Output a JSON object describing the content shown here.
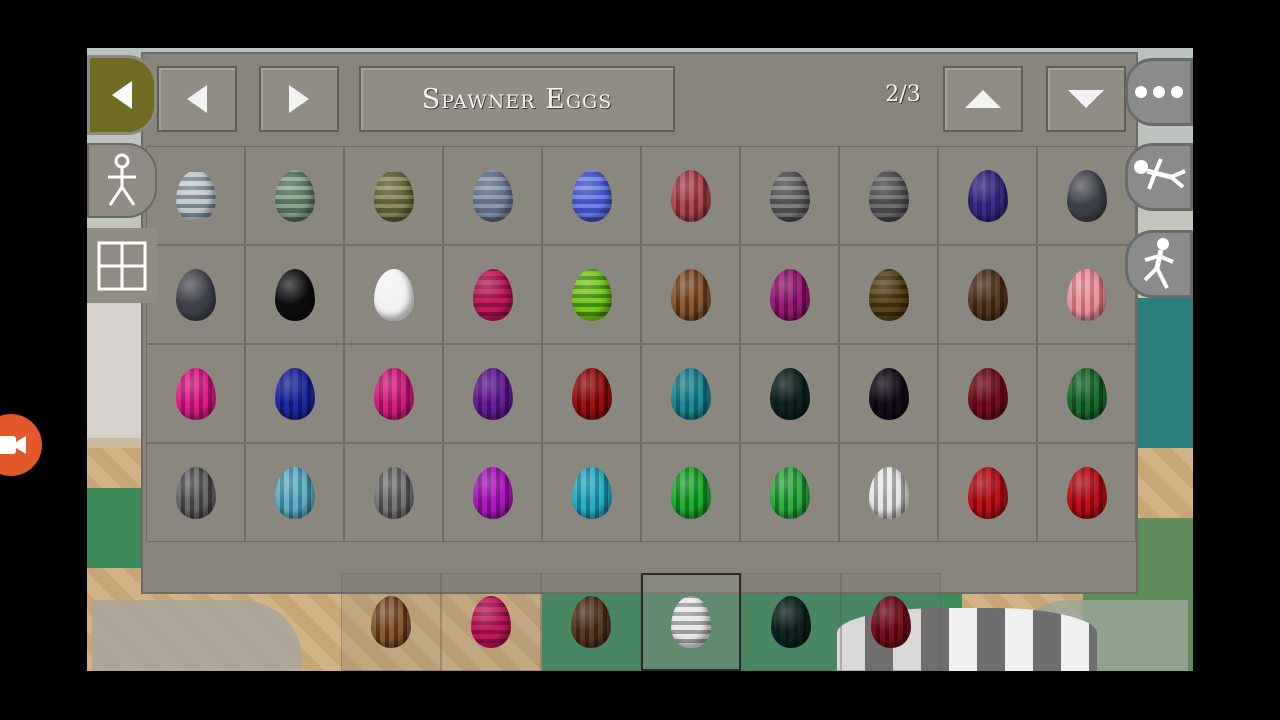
{
  "inventory": {
    "title": "Spawner Eggs",
    "page": "2/3"
  },
  "icons": {
    "back": "back-arrow-icon",
    "prev": "left-arrow-icon",
    "next": "right-arrow-icon",
    "up": "up-arrow-icon",
    "down": "down-arrow-icon",
    "menu": "more-dots-icon",
    "walk": "stickman-walk-icon",
    "grid": "grid-icon",
    "fly": "stickman-fly-icon",
    "run": "stickman-run-icon",
    "record": "video-camera-icon"
  },
  "eggs": [
    [
      {
        "base": "#c8c8c8",
        "stripe": "#6e8796",
        "pattern": "h"
      },
      {
        "base": "#4f7056",
        "stripe": "#8ea18e",
        "pattern": "h"
      },
      {
        "base": "#5b5a35",
        "stripe": "#8e8b58",
        "pattern": "h"
      },
      {
        "base": "#5d6a82",
        "stripe": "#8797ad",
        "pattern": "h"
      },
      {
        "base": "#3e4fbf",
        "stripe": "#6d80e6",
        "pattern": "h"
      },
      {
        "base": "#b04a52",
        "stripe": "#7e2a32",
        "pattern": "v"
      },
      {
        "base": "#4c4c4c",
        "stripe": "#7d7d7d",
        "pattern": "h"
      },
      {
        "base": "#474747",
        "stripe": "#6f6f6f",
        "pattern": "h"
      },
      {
        "base": "#2c1f6a",
        "stripe": "#3c2c8c",
        "pattern": "v"
      },
      {
        "base": "#3d4048",
        "stripe": "#3d4048",
        "pattern": "solid"
      }
    ],
    [
      {
        "base": "#3d4048",
        "stripe": "#3d4048",
        "pattern": "solid"
      },
      {
        "base": "#0c0c0c",
        "stripe": "#0c0c0c",
        "pattern": "solid"
      },
      {
        "base": "#f2f2f2",
        "stripe": "#f2f2f2",
        "pattern": "solid"
      },
      {
        "base": "#c2185b",
        "stripe": "#8e0f43",
        "pattern": "h"
      },
      {
        "base": "#79c81e",
        "stripe": "#3f8c12",
        "pattern": "h"
      },
      {
        "base": "#8a5a30",
        "stripe": "#5a3418",
        "pattern": "v"
      },
      {
        "base": "#9c1a7a",
        "stripe": "#6a0e52",
        "pattern": "v"
      },
      {
        "base": "#5c4618",
        "stripe": "#3a2c0c",
        "pattern": "h"
      },
      {
        "base": "#5a3a24",
        "stripe": "#3a2414",
        "pattern": "v"
      },
      {
        "base": "#e89aa0",
        "stripe": "#c36a72",
        "pattern": "v"
      }
    ],
    [
      {
        "base": "#e0208a",
        "stripe": "#a8106a",
        "pattern": "v"
      },
      {
        "base": "#1e2aa8",
        "stripe": "#121a72",
        "pattern": "v"
      },
      {
        "base": "#d81e82",
        "stripe": "#a01060",
        "pattern": "v"
      },
      {
        "base": "#6a1e98",
        "stripe": "#4a1070",
        "pattern": "v"
      },
      {
        "base": "#9a1212",
        "stripe": "#6a0808",
        "pattern": "v"
      },
      {
        "base": "#1e8a98",
        "stripe": "#106070",
        "pattern": "v"
      },
      {
        "base": "#0e2420",
        "stripe": "#0a1a16",
        "pattern": "v"
      },
      {
        "base": "#150f1a",
        "stripe": "#0c0810",
        "pattern": "v"
      },
      {
        "base": "#7a0e1e",
        "stripe": "#500812",
        "pattern": "v"
      },
      {
        "base": "#1a7030",
        "stripe": "#0e4a1c",
        "pattern": "v"
      }
    ],
    [
      {
        "base": "#6a6a6a",
        "stripe": "#3e3e3e",
        "pattern": "v"
      },
      {
        "base": "#62b0c8",
        "stripe": "#3a8098",
        "pattern": "v"
      },
      {
        "base": "#7a7a7a",
        "stripe": "#4c4c4c",
        "pattern": "v"
      },
      {
        "base": "#b018c0",
        "stripe": "#7c0e88",
        "pattern": "v"
      },
      {
        "base": "#28b0c8",
        "stripe": "#167c90",
        "pattern": "v"
      },
      {
        "base": "#20b030",
        "stripe": "#107a1e",
        "pattern": "v"
      },
      {
        "base": "#30b040",
        "stripe": "#18782a",
        "pattern": "v"
      },
      {
        "base": "#e8e8e8",
        "stripe": "#9a9a9a",
        "pattern": "v"
      },
      {
        "base": "#c01018",
        "stripe": "#8a0810",
        "pattern": "v"
      },
      {
        "base": "#c01018",
        "stripe": "#8a0810",
        "pattern": "v"
      }
    ]
  ],
  "hotbar": [
    {
      "base": "#8a5a30",
      "stripe": "#5a3418",
      "pattern": "v"
    },
    {
      "base": "#c2185b",
      "stripe": "#8e0f43",
      "pattern": "h"
    },
    {
      "base": "#5a3a24",
      "stripe": "#3a2414",
      "pattern": "v"
    },
    {
      "base": "#e8e8e8",
      "stripe": "#9a9a9a",
      "pattern": "h"
    },
    {
      "base": "#0e2420",
      "stripe": "#0a1a16",
      "pattern": "v"
    },
    {
      "base": "#7a0e1e",
      "stripe": "#500812",
      "pattern": "v"
    }
  ],
  "hotbar_selected": 3
}
